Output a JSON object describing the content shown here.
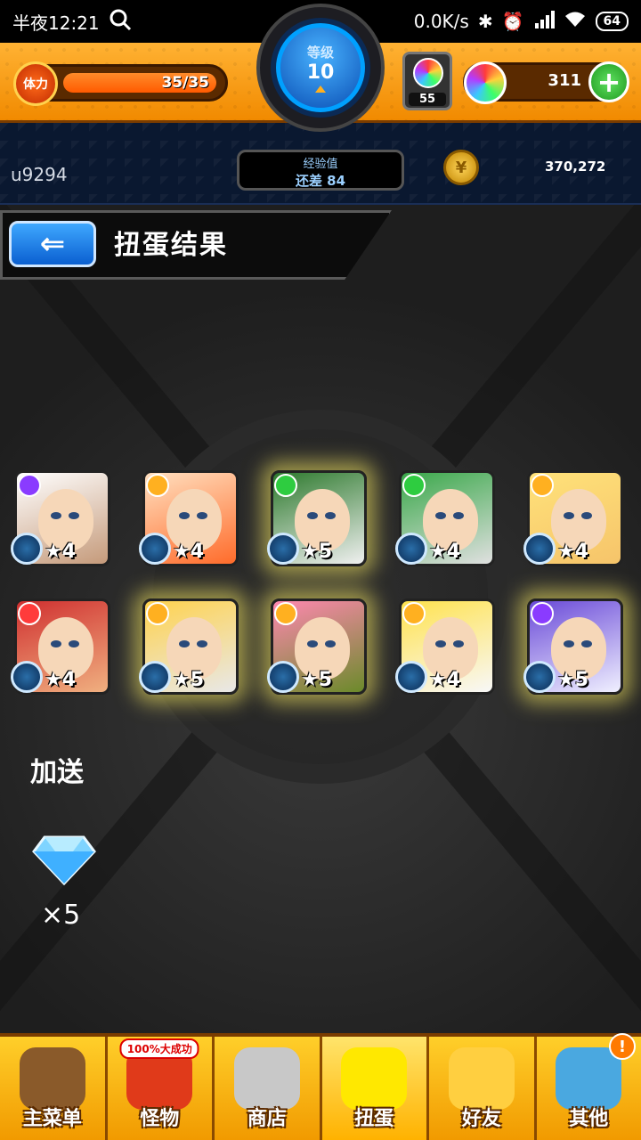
{
  "status_bar": {
    "time": "半夜12:21",
    "net_speed": "0.0K/s",
    "battery": "64"
  },
  "header": {
    "stamina_label": "体力",
    "stamina_value": "35/35",
    "stamina_fraction": 1.0,
    "level_label": "等级",
    "level_value": "10",
    "orb_count": "55",
    "gem_count": "311",
    "plus_label": "+"
  },
  "user": {
    "name": "u9294",
    "exp_label": "经验值",
    "exp_remaining": "还差 84",
    "coins": "370,272"
  },
  "result": {
    "title": "扭蛋结果",
    "cards": [
      {
        "stars": "★4",
        "glow": false,
        "element": "#8a3bff",
        "art": [
          "#ffffff",
          "#c59a7a"
        ]
      },
      {
        "stars": "★4",
        "glow": false,
        "element": "#ffb020",
        "art": [
          "#ffe0c0",
          "#ff6b2a"
        ]
      },
      {
        "stars": "★5",
        "glow": true,
        "element": "#2ecc40",
        "art": [
          "#2e7a2e",
          "#f0f0f0"
        ]
      },
      {
        "stars": "★4",
        "glow": false,
        "element": "#2ecc40",
        "art": [
          "#3aa84a",
          "#e0e0e0"
        ]
      },
      {
        "stars": "★4",
        "glow": false,
        "element": "#ffb020",
        "art": [
          "#ffe27a",
          "#f6c46a"
        ]
      },
      {
        "stars": "★4",
        "glow": false,
        "element": "#ff3b3b",
        "art": [
          "#d03030",
          "#f0b080"
        ]
      },
      {
        "stars": "★5",
        "glow": true,
        "element": "#ffb020",
        "art": [
          "#ffd24d",
          "#e8e8e8"
        ]
      },
      {
        "stars": "★5",
        "glow": true,
        "element": "#ffb020",
        "art": [
          "#ff88b0",
          "#6b8a2a"
        ]
      },
      {
        "stars": "★4",
        "glow": false,
        "element": "#ffb020",
        "art": [
          "#ffe24d",
          "#f8f8f8"
        ]
      },
      {
        "stars": "★5",
        "glow": true,
        "element": "#8a3bff",
        "art": [
          "#6a4ad8",
          "#f0f0ff"
        ]
      }
    ],
    "bonus_label": "加送",
    "bonus_count": "×5"
  },
  "nav": {
    "items": [
      {
        "label": "主菜单",
        "icon": "gate-icon",
        "color": "#8a5a2a"
      },
      {
        "label": "怪物",
        "icon": "monster-icon",
        "color": "#e03a1a",
        "promo": "100%大成功"
      },
      {
        "label": "商店",
        "icon": "orb-icon",
        "color": "#c8c8c8"
      },
      {
        "label": "扭蛋",
        "icon": "egg-icon",
        "color": "#ffe800",
        "active": true
      },
      {
        "label": "好友",
        "icon": "friends-icon",
        "color": "#ffcf40"
      },
      {
        "label": "其他",
        "icon": "other-icon",
        "color": "#4aa8e0",
        "alert": "!"
      }
    ]
  }
}
